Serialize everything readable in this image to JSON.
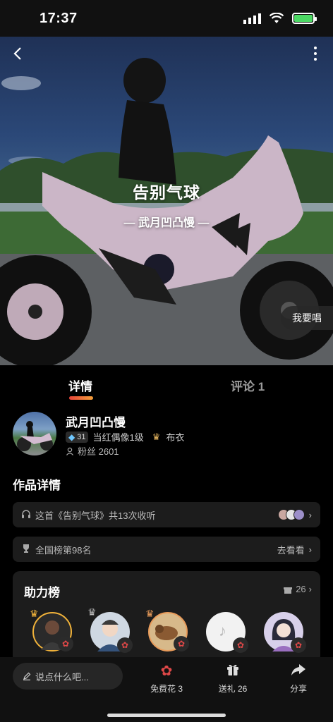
{
  "status": {
    "time": "17:37"
  },
  "hero": {
    "song_title": "告别气球",
    "artist": "— 武月凹凸慢 —",
    "sing_button": "我要唱"
  },
  "tabs": [
    {
      "label": "详情",
      "active": true
    },
    {
      "label": "评论 1",
      "active": false
    }
  ],
  "profile": {
    "name": "武月凹凸慢",
    "level": "31",
    "title": "当红偶像1级",
    "rank_name": "布衣",
    "fans": "粉丝 2601"
  },
  "works": {
    "section_title": "作品详情",
    "listen_text": "这首《告别气球》共13次收听",
    "national_rank": "全国榜第98名",
    "go_see": "去看看"
  },
  "support": {
    "title": "助力榜",
    "count": "26"
  },
  "bottom": {
    "comment_placeholder": "说点什么吧...",
    "free_flower": "免费花 3",
    "gift": "送礼 26",
    "share": "分享"
  },
  "colors": {
    "background": "#000000",
    "card": "#1c1c1c",
    "accent_gradient_start": "#e8443a",
    "accent_gradient_end": "#f3a03a"
  }
}
